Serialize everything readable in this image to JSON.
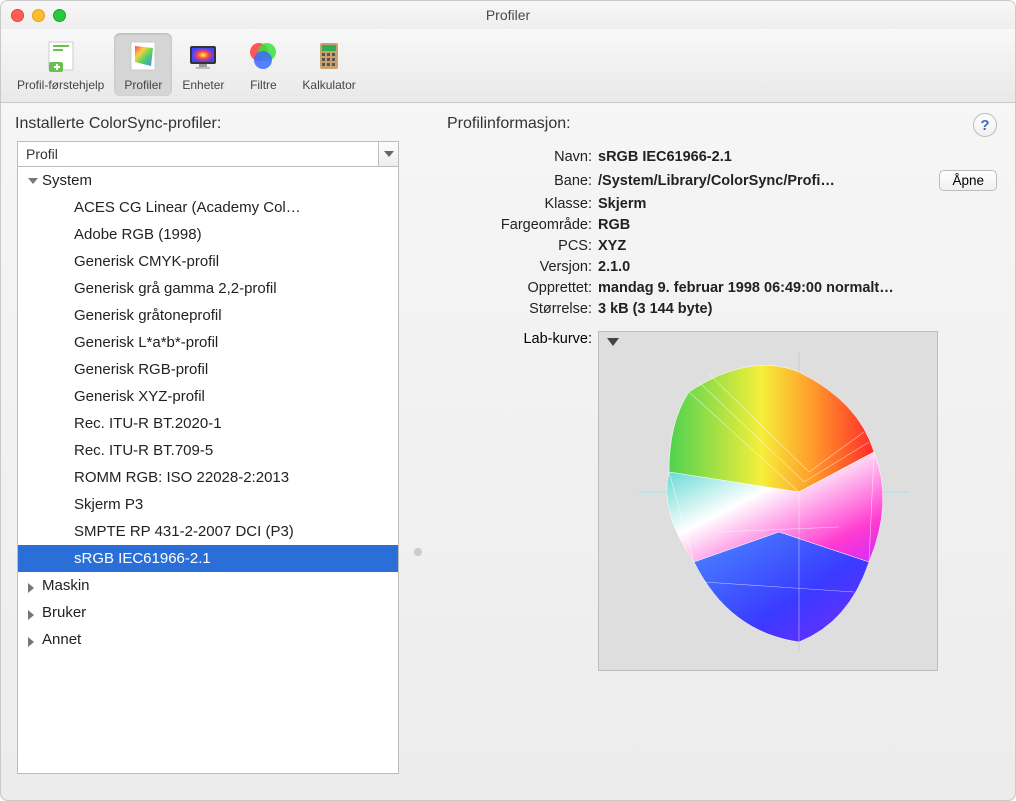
{
  "window": {
    "title": "Profiler"
  },
  "toolbar": {
    "items": [
      {
        "label": "Profil-førstehjelp"
      },
      {
        "label": "Profiler"
      },
      {
        "label": "Enheter"
      },
      {
        "label": "Filtre"
      },
      {
        "label": "Kalkulator"
      }
    ]
  },
  "left": {
    "header": "Installerte ColorSync-profiler:",
    "dropdown": "Profil",
    "groups": {
      "system": "System",
      "maskin": "Maskin",
      "bruker": "Bruker",
      "annet": "Annet"
    },
    "system_items": [
      "ACES CG Linear (Academy Col…",
      "Adobe RGB (1998)",
      "Generisk CMYK-profil",
      "Generisk grå gamma 2,2-profil",
      "Generisk gråtoneprofil",
      "Generisk L*a*b*-profil",
      "Generisk RGB-profil",
      "Generisk XYZ-profil",
      "Rec. ITU-R BT.2020-1",
      "Rec. ITU-R BT.709-5",
      "ROMM RGB: ISO 22028-2:2013",
      "Skjerm P3",
      "SMPTE RP 431-2-2007 DCI (P3)",
      "sRGB IEC61966-2.1"
    ]
  },
  "right": {
    "header": "Profilinformasjon:",
    "open_button": "Åpne",
    "labels": {
      "name": "Navn:",
      "path": "Bane:",
      "class": "Klasse:",
      "colorspace": "Fargeområde:",
      "pcs": "PCS:",
      "version": "Versjon:",
      "created": "Opprettet:",
      "size": "Størrelse:",
      "lab": "Lab-kurve:"
    },
    "values": {
      "name": "sRGB IEC61966-2.1",
      "path": "/System/Library/ColorSync/Profi…",
      "class": "Skjerm",
      "colorspace": "RGB",
      "pcs": "XYZ",
      "version": "2.1.0",
      "created": "mandag 9. februar 1998 06:49:00 normalt…",
      "size": "3 kB (3 144 byte)"
    }
  },
  "help": "?"
}
